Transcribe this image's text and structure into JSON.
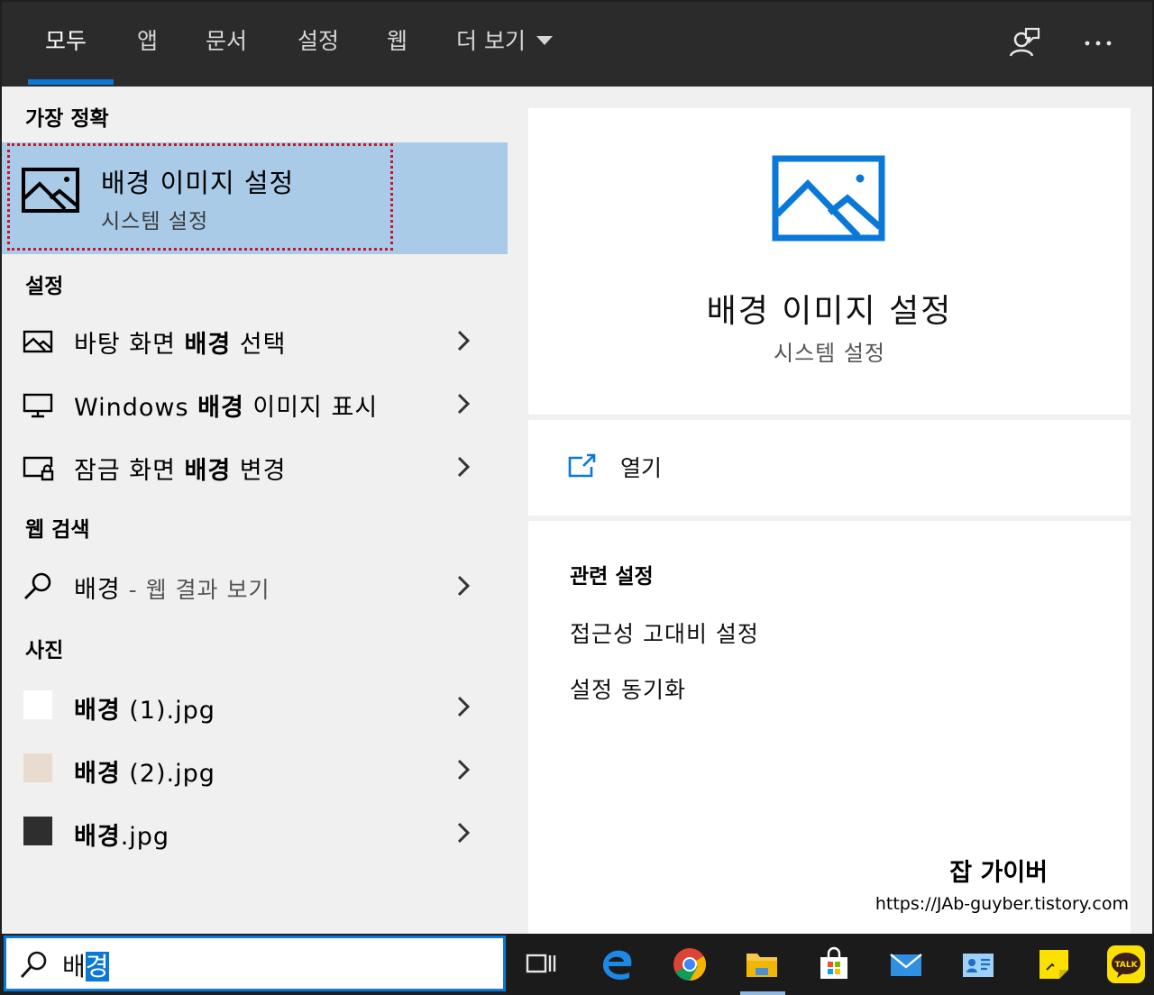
{
  "tabs": [
    {
      "label": "모두",
      "active": true
    },
    {
      "label": "앱"
    },
    {
      "label": "문서"
    },
    {
      "label": "설정"
    },
    {
      "label": "웹"
    },
    {
      "label": "더 보기"
    }
  ],
  "top_icons": [
    "feedback-icon",
    "more-icon"
  ],
  "best_match": {
    "heading": "가장 정확",
    "title": "배경 이미지 설정",
    "subtitle": "시스템 설정",
    "icon": "picture-icon"
  },
  "settings": {
    "heading": "설정",
    "items": [
      {
        "pre": "바탕 화면 ",
        "bold": "배경",
        "post": " 선택",
        "icon": "picture-icon"
      },
      {
        "pre": "Windows ",
        "bold": "배경",
        "post": " 이미지 표시",
        "icon": "monitor-icon"
      },
      {
        "pre": "잠금 화면 ",
        "bold": "배경",
        "post": " 변경",
        "icon": "lock-screen-icon"
      }
    ]
  },
  "web": {
    "heading": "웹 검색",
    "item": {
      "term": "배경",
      "suffix": " - 웹 결과 보기",
      "icon": "search-icon"
    }
  },
  "photos": {
    "heading": "사진",
    "items": [
      {
        "bold": "배경",
        "post": " (1).jpg",
        "thumb": "#ffffff"
      },
      {
        "bold": "배경",
        "post": " (2).jpg",
        "thumb": "#e9dccf"
      },
      {
        "bold": "배경",
        "post": ".jpg",
        "thumb": "#2e2e2e"
      }
    ]
  },
  "preview": {
    "title": "배경 이미지 설정",
    "subtitle": "시스템 설정",
    "open_label": "열기",
    "related_heading": "관련 설정",
    "related_links": [
      "접근성 고대비 설정",
      "설정 동기화"
    ]
  },
  "watermark": {
    "name": "잡 가이버",
    "url": "https://JAb-guyber.tistory.com"
  },
  "search": {
    "prefix": "배",
    "selected": "경"
  },
  "taskbar_icons": [
    "task-view-icon",
    "edge-icon",
    "chrome-icon",
    "file-explorer-icon",
    "store-icon",
    "mail-icon",
    "contacts-icon",
    "sticky-notes-icon",
    "kakaotalk-icon"
  ],
  "colors": {
    "accent": "#0a78d7",
    "selection": "#a9cbe8",
    "outline": "#c4162c"
  }
}
